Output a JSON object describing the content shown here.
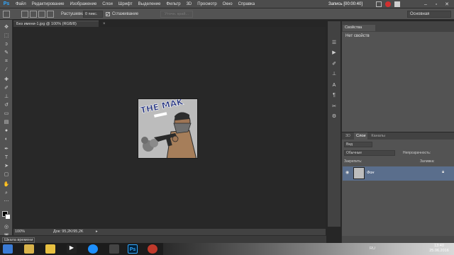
{
  "app": {
    "logo": "Ps"
  },
  "menu": [
    "Файл",
    "Редактирование",
    "Изображение",
    "Слои",
    "Шрифт",
    "Выделение",
    "Фильтр",
    "3D",
    "Просмотр",
    "Окно",
    "Справка"
  ],
  "recording": {
    "label": "Запись [00:00:40]",
    "colors": {
      "dot": "#d23030"
    }
  },
  "options": {
    "feather_label": "Растушевка:",
    "feather_value": "0 пикс.",
    "antialias_label": "Сглаживание",
    "antialias_checked": true,
    "refine_edge": "Уточн. край...",
    "workspace": "Основная"
  },
  "document": {
    "tab_title": "Без имени-1.jpg @ 100% (RGB/8)",
    "zoom": "100%",
    "doc_size": "Док: 95,2K/95,2K",
    "artwork_text": "THE MAK"
  },
  "timeline": {
    "label": "Шкала времени"
  },
  "properties": {
    "tab": "Свойства",
    "empty": "Нет свойств"
  },
  "layers": {
    "tabs": [
      "3D",
      "Слои",
      "Каналы"
    ],
    "active_tab": "Слои",
    "kind": "Вид",
    "blend_mode": "Обычные",
    "opacity_label": "Непрозрачность:",
    "lock_label": "Закрепить:",
    "fill_label": "Заливка:",
    "layer_name": "Фон"
  },
  "taskbar": {
    "lang": "RU",
    "time": "13:40",
    "date": "25.06.2016"
  }
}
